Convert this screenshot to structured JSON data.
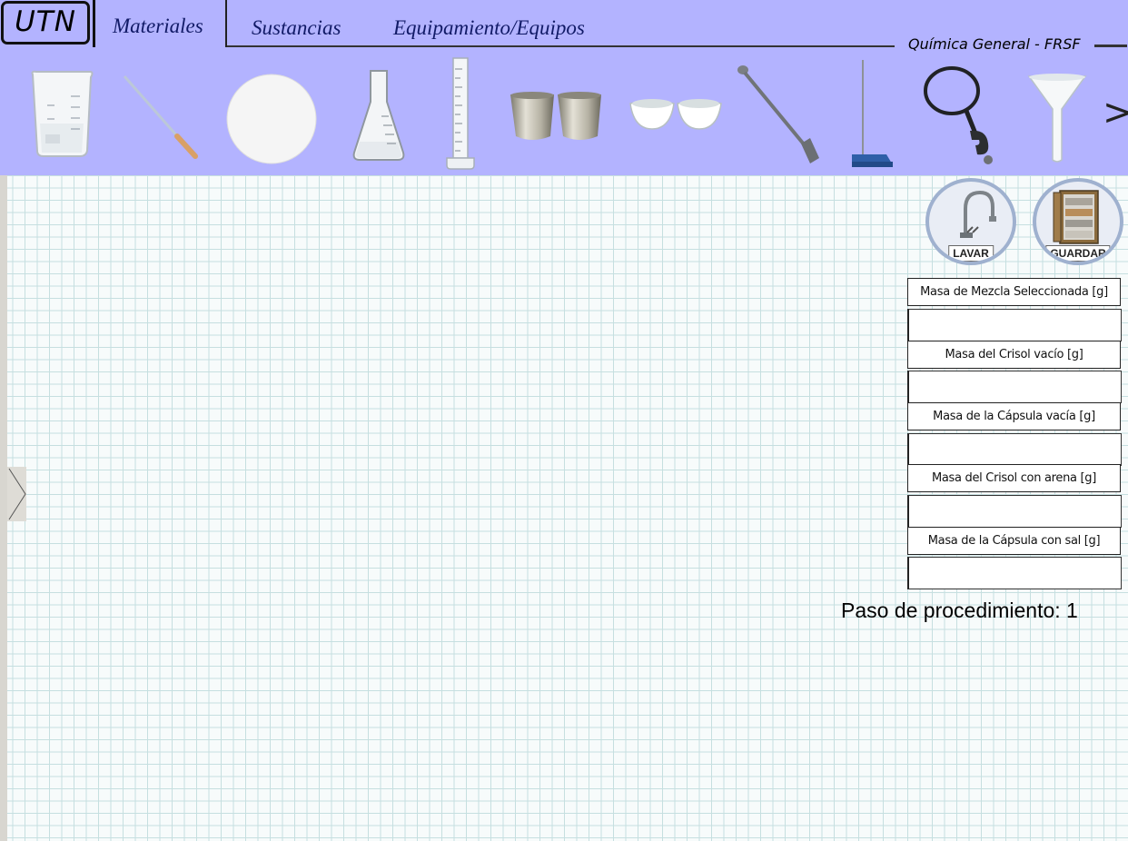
{
  "header": {
    "logo": "UTN",
    "tabs": [
      {
        "label": "Materiales",
        "active": true
      },
      {
        "label": "Sustancias",
        "active": false
      },
      {
        "label": "Equipamiento/Equipos",
        "active": false
      }
    ],
    "course": "Química General - FRSF",
    "next_arrow": ">",
    "background_color": "#b3b3ff"
  },
  "tools": [
    {
      "icon": "beaker-icon"
    },
    {
      "icon": "pipette-icon"
    },
    {
      "icon": "filter-paper-icon"
    },
    {
      "icon": "erlenmeyer-flask-icon"
    },
    {
      "icon": "graduated-cylinder-icon"
    },
    {
      "icon": "crucibles-icon"
    },
    {
      "icon": "evaporating-dishes-icon"
    },
    {
      "icon": "spatula-icon"
    },
    {
      "icon": "ring-stand-icon"
    },
    {
      "icon": "ring-clamp-icon"
    },
    {
      "icon": "funnel-icon"
    }
  ],
  "actions": {
    "wash_label": "LAVAR",
    "save_label": "GUARDAR"
  },
  "masses": [
    {
      "label": "Masa de Mezcla Seleccionada [g]",
      "value": ""
    },
    {
      "label": "Masa del Crisol vacío [g]",
      "value": ""
    },
    {
      "label": "Masa de la Cápsula vacía [g]",
      "value": ""
    },
    {
      "label": "Masa del Crisol con arena [g]",
      "value": ""
    },
    {
      "label": "Masa de la Cápsula con sal [g]",
      "value": ""
    }
  ],
  "status": {
    "step_text": "Paso de procedimiento: 1"
  }
}
